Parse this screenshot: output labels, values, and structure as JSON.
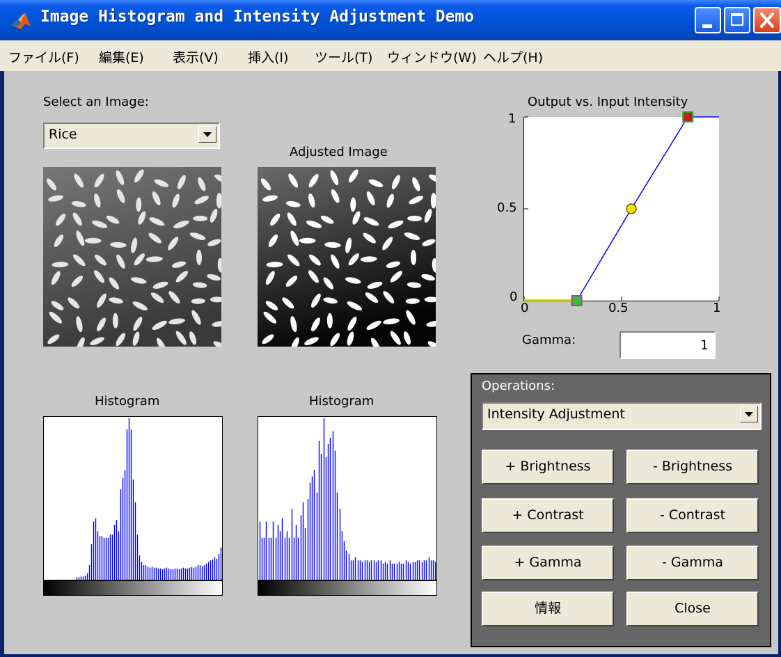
{
  "window": {
    "title": "Image Histogram and Intensity Adjustment Demo",
    "accent": "#0052d6",
    "controls": [
      "minimize-icon",
      "maximize-icon",
      "close-icon"
    ]
  },
  "menu": [
    "ファイル(F)",
    "編集(E)",
    "表示(V)",
    "挿入(I)",
    "ツール(T)",
    "ウィンドウ(W)",
    "ヘルプ(H)"
  ],
  "image_select": {
    "label": "Select an Image:",
    "value": "Rice"
  },
  "adjusted_label": "Adjusted Image",
  "histogram_labels": {
    "left": "Histogram",
    "right": "Histogram"
  },
  "intensity_plot": {
    "title": "Output vs. Input Intensity",
    "y_ticks": [
      "1",
      "0.5",
      "0"
    ],
    "x_ticks": [
      "0",
      "0.5",
      "1"
    ]
  },
  "gamma": {
    "label": "Gamma:",
    "value": "1"
  },
  "operations": {
    "label": "Operations:",
    "selected": "Intensity Adjustment",
    "buttons": {
      "plus_brightness": "+ Brightness",
      "minus_brightness": "- Brightness",
      "plus_contrast": "+ Contrast",
      "minus_contrast": "- Contrast",
      "plus_gamma": "+ Gamma",
      "minus_gamma": "- Gamma",
      "info": "情報",
      "close": "Close"
    }
  },
  "chart_data": [
    {
      "type": "line",
      "title": "Output vs. Input Intensity",
      "xlim": [
        0,
        1
      ],
      "ylim": [
        0,
        1
      ],
      "x": [
        0,
        0.27,
        0.55,
        0.84,
        1
      ],
      "y": [
        0,
        0,
        0.5,
        1,
        1
      ],
      "control_points": {
        "low": [
          0.27,
          0
        ],
        "mid": [
          0.55,
          0.5
        ],
        "high": [
          0.84,
          1
        ]
      },
      "line_color": "#0000ff"
    },
    {
      "type": "bar",
      "title": "Histogram",
      "color": "#0000ff",
      "values": [
        0,
        0,
        0,
        0,
        0,
        0,
        0,
        0,
        0,
        0,
        0,
        0,
        0,
        0,
        0,
        1.5,
        1.5,
        2,
        2,
        2.5,
        4,
        9,
        22,
        36,
        38,
        30,
        27,
        27,
        26,
        26,
        26,
        28,
        28,
        34,
        37,
        30,
        56,
        63,
        68,
        93,
        100,
        93,
        62,
        48,
        28,
        15,
        11,
        9,
        9,
        8,
        7.5,
        8,
        7.5,
        7.5,
        7,
        7,
        6.5,
        7,
        7.5,
        7,
        6.5,
        6.5,
        7,
        7,
        6.5,
        7,
        7.5,
        7,
        7,
        7.5,
        8,
        7.5,
        8,
        9,
        9,
        8.5,
        9,
        10,
        11,
        12,
        12.5,
        14,
        13,
        16,
        20
      ]
    },
    {
      "type": "bar",
      "title": "Histogram",
      "color": "#0000ff",
      "values": [
        18,
        13,
        13,
        18,
        13,
        13,
        18,
        13,
        17,
        15,
        19,
        13,
        15,
        13,
        22,
        13,
        17,
        13,
        20,
        24,
        16,
        25,
        30,
        32,
        34,
        27,
        43,
        39,
        50,
        38,
        42,
        44,
        46,
        40,
        27,
        22,
        15,
        12,
        9,
        8,
        6,
        6,
        7,
        6,
        6,
        5.5,
        6,
        6,
        5.5,
        6,
        6,
        5.5,
        6,
        6,
        5,
        5.5,
        5,
        6,
        5,
        5,
        5,
        5.5,
        5,
        5,
        6,
        5.5,
        5,
        5.5,
        5.5,
        6,
        6,
        5.5,
        6,
        6,
        7,
        6,
        6,
        5.5
      ]
    }
  ]
}
